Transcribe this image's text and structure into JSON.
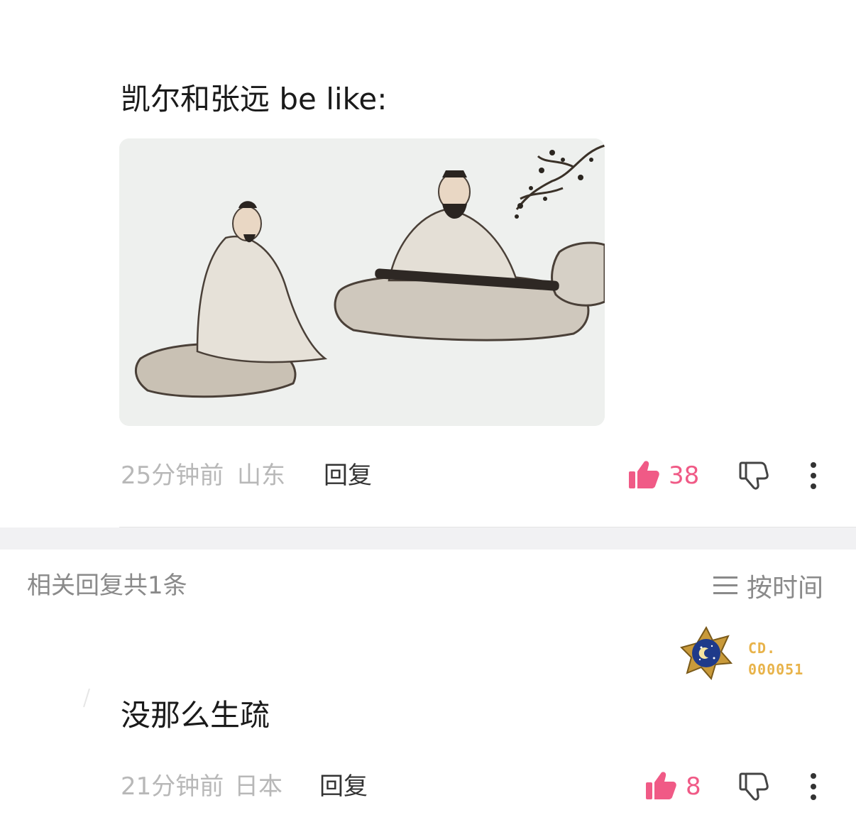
{
  "comment": {
    "text": "凯尔和张远 be like:",
    "image_alt": "ink painting of two scholars, one playing guqin",
    "time": "25分钟前",
    "location": "山东",
    "reply_label": "回复",
    "likes": "38"
  },
  "replies": {
    "header": "相关回复共1条",
    "sort_label": "按时间",
    "items": [
      {
        "badge_line1": "CD.",
        "badge_line2": "000051",
        "text": "没那么生疏",
        "time": "21分钟前",
        "location": "日本",
        "reply_label": "回复",
        "likes": "8"
      }
    ]
  },
  "colors": {
    "like": "#f05a86",
    "meta": "#b8b8b8",
    "badge_gold": "#e8b34a"
  },
  "icons": [
    "thumbs-up-icon",
    "thumbs-down-icon",
    "more-vertical-icon",
    "menu-lines-icon",
    "star-badge-icon"
  ]
}
